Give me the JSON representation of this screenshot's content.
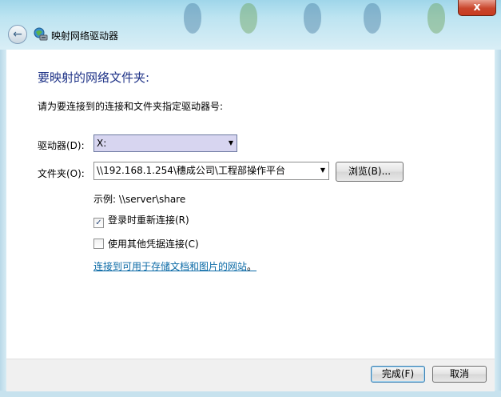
{
  "window": {
    "title": "映射网络驱动器",
    "close_glyph": "x"
  },
  "main": {
    "heading": "要映射的网络文件夹:",
    "instruction": "请为要连接到的连接和文件夹指定驱动器号:",
    "drive": {
      "label": "驱动器(D):",
      "value": "X:"
    },
    "folder": {
      "label": "文件夹(O):",
      "value": "\\\\192.168.1.254\\穗成公司\\工程部操作平台",
      "browse_label": "浏览(B)..."
    },
    "example": "示例: \\\\server\\share",
    "reconnect": {
      "label": "登录时重新连接(R)",
      "checked": true
    },
    "other_credentials": {
      "label": "使用其他凭据连接(C)",
      "checked": false
    },
    "link_text": "连接到可用于存储文档和图片的网站",
    "link_suffix": "。"
  },
  "footer": {
    "finish_label": "完成(F)",
    "cancel_label": "取消"
  },
  "icons": {
    "back": "back-arrow-icon",
    "wizard": "network-drive-icon",
    "dropdown": "chevron-down-icon"
  }
}
